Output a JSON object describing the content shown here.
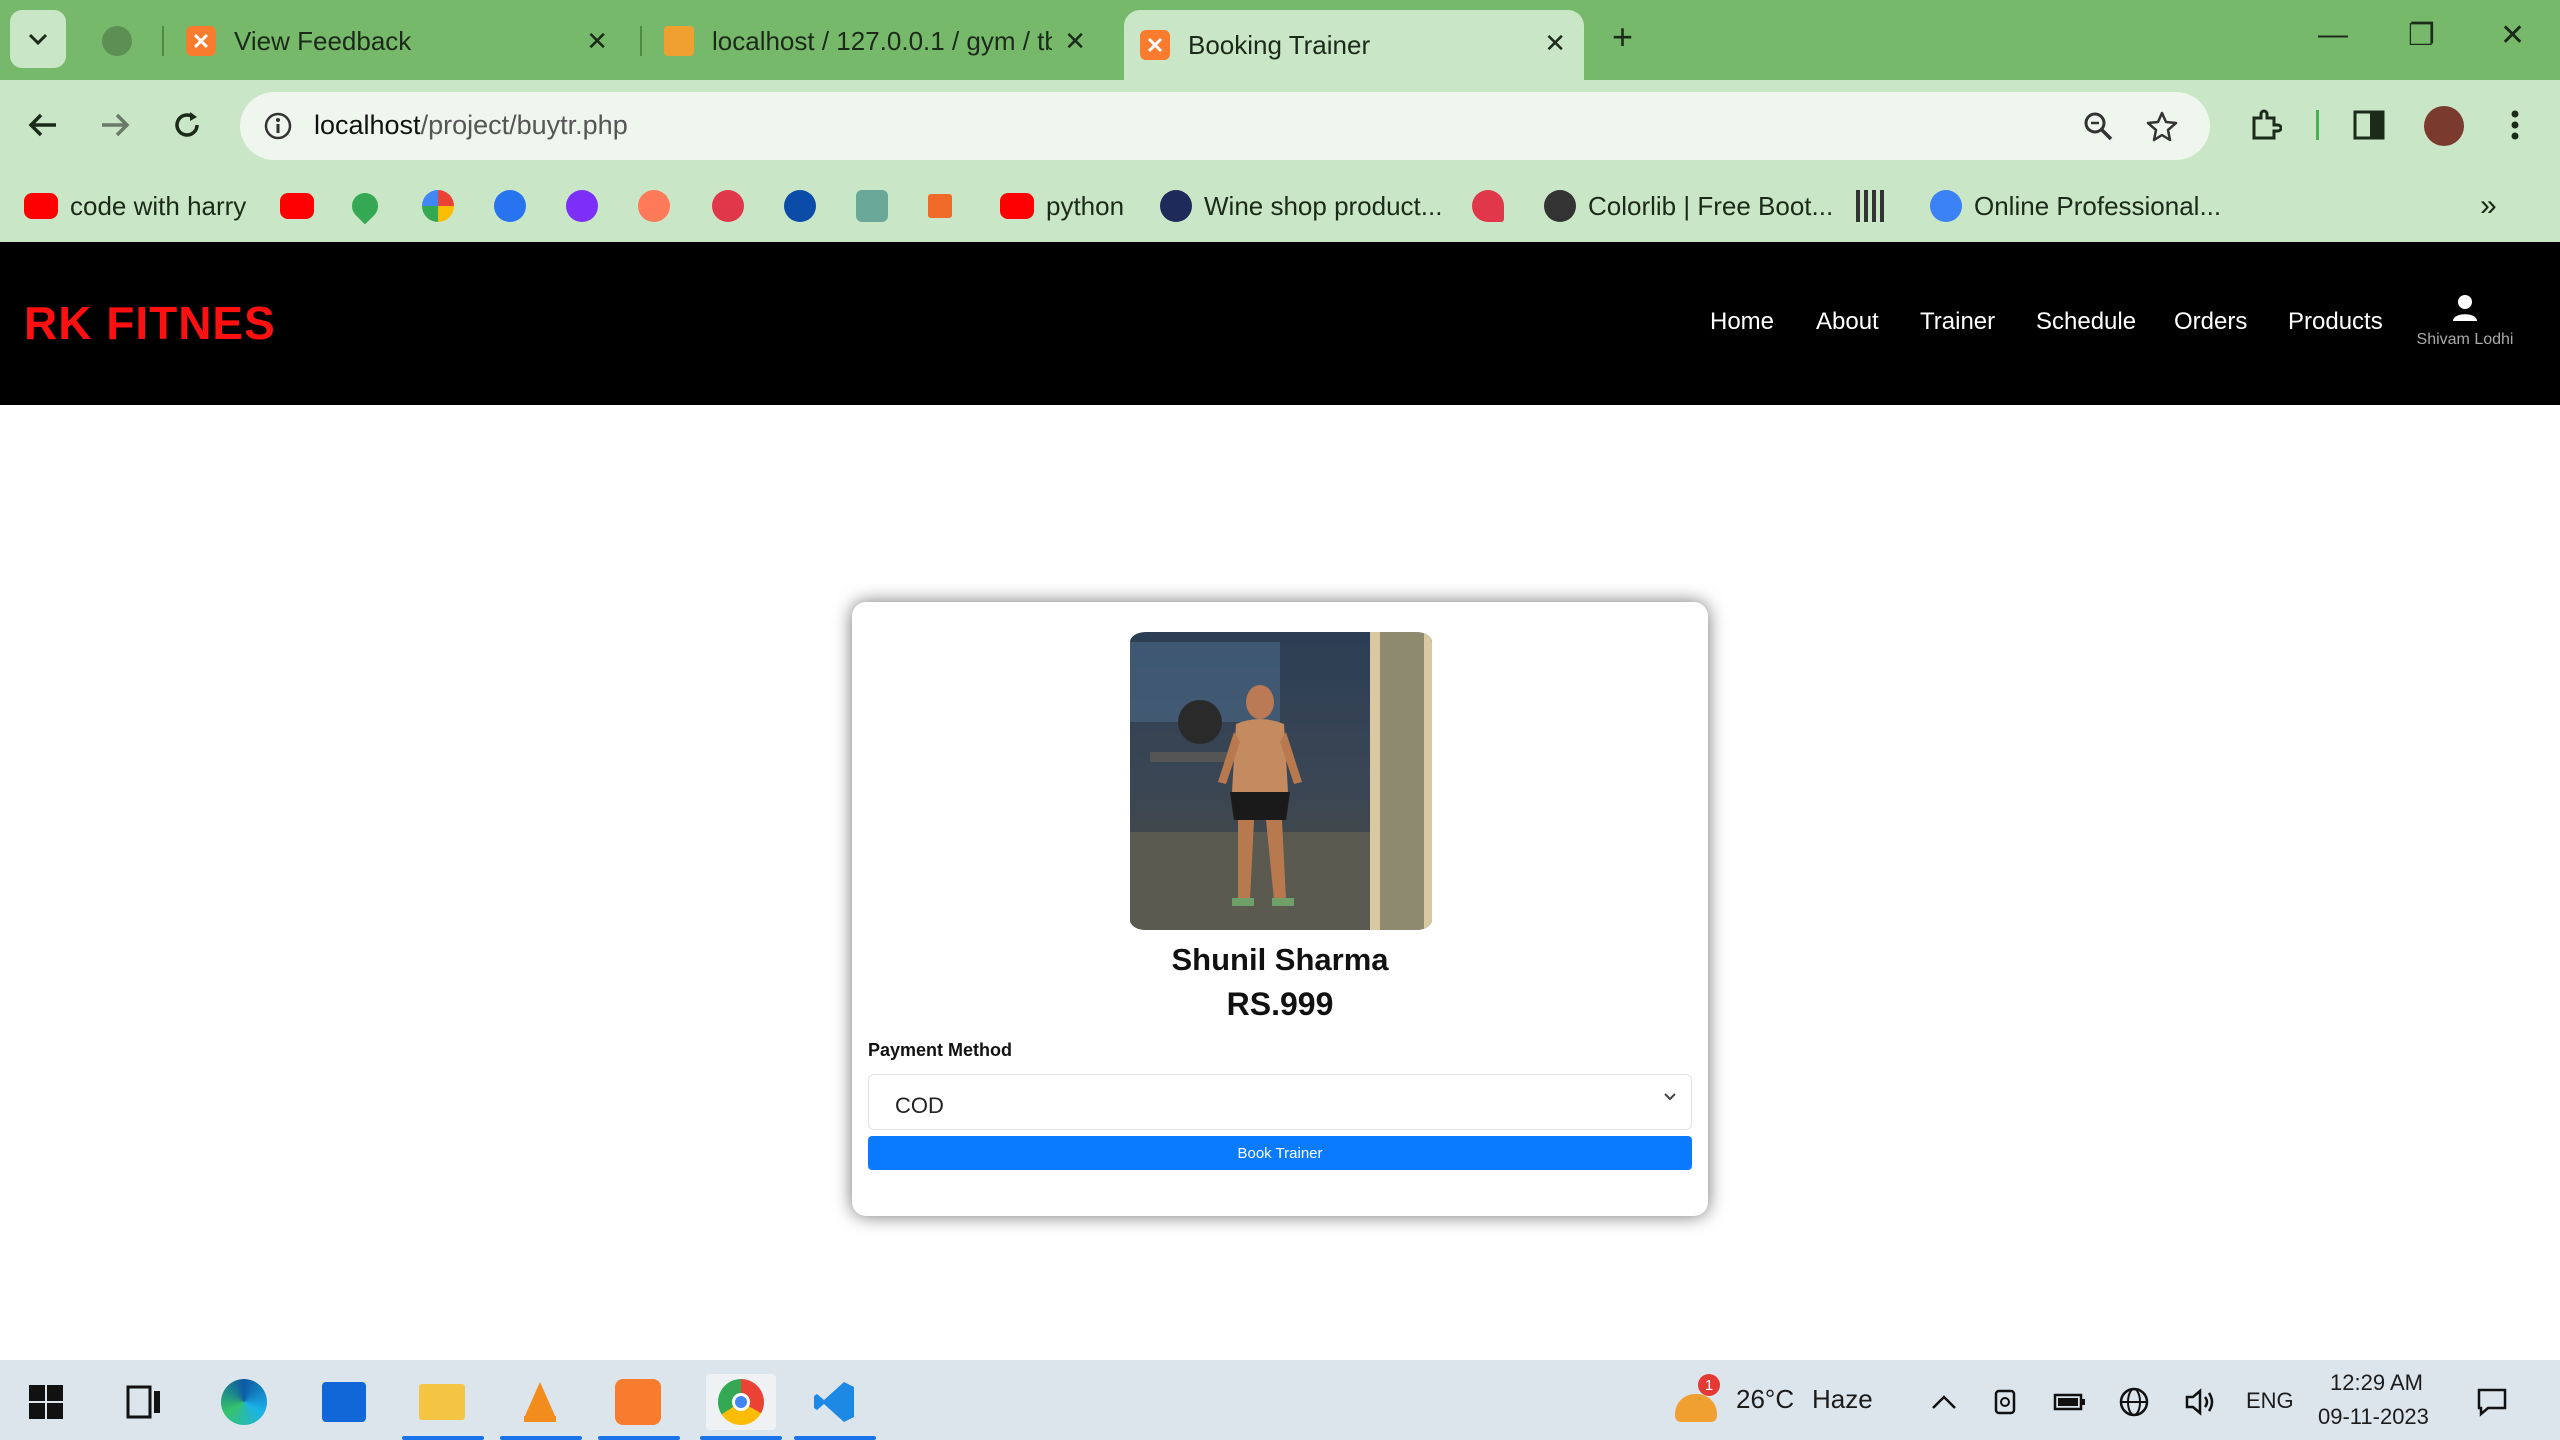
{
  "browser": {
    "tabs": [
      {
        "title": "View Feedback"
      },
      {
        "title": "localhost / 127.0.0.1 / gym / tb"
      },
      {
        "title": "Booking Trainer"
      }
    ],
    "url_host": "localhost",
    "url_path": "/project/buytr.php",
    "bookmarks": [
      {
        "label": "code with harry"
      },
      {
        "label": "python"
      },
      {
        "label": "Wine shop product..."
      },
      {
        "label": "Colorlib | Free Boot..."
      },
      {
        "label": "Online Professional..."
      }
    ]
  },
  "site": {
    "brand": "RK FITNES",
    "nav": [
      "Home",
      "About",
      "Trainer",
      "Schedule",
      "Orders",
      "Products"
    ],
    "user_name": "Shivam Lodhi"
  },
  "card": {
    "trainer_name": "Shunil Sharma",
    "price": "RS.999",
    "payment_label": "Payment Method",
    "payment_value": "COD",
    "book_button": "Book Trainer"
  },
  "taskbar": {
    "weather_badge": "1",
    "weather_temp": "26°C",
    "weather_desc": "Haze",
    "lang": "ENG",
    "time": "12:29 AM",
    "date": "09-11-2023"
  },
  "colors": {
    "tabstrip": "#77b96a",
    "toolbar": "#c9e6c6",
    "brand": "#ff1010",
    "button": "#0a7bff"
  }
}
